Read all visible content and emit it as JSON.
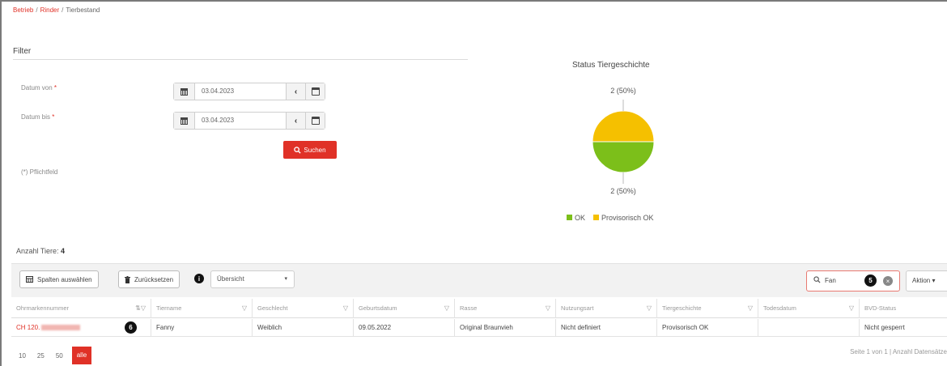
{
  "breadcrumb": {
    "items": [
      "Betrieb",
      "Rinder",
      "Tierbestand"
    ],
    "separator": "/"
  },
  "filter": {
    "title": "Filter",
    "date_from_label": "Datum von",
    "date_to_label": "Datum bis",
    "required_mark": "*",
    "date_from_value": "03.04.2023",
    "date_to_value": "03.04.2023",
    "prev_glyph": "‹",
    "search_label": "Suchen",
    "required_note": "(*) Pflichtfeld"
  },
  "chart_data": {
    "type": "pie",
    "title": "Status Tiergeschichte",
    "categories": [
      "OK",
      "Provisorisch OK"
    ],
    "values": [
      2,
      2
    ],
    "data_labels": [
      "2 (50%)",
      "2 (50%)"
    ],
    "colors": {
      "OK": "#7cbf1a",
      "Provisorisch OK": "#f5c000"
    },
    "legend_position": "bottom"
  },
  "summary": {
    "count_label": "Anzahl Tiere:",
    "count_value": "4"
  },
  "toolbar": {
    "columns_label": "Spalten auswählen",
    "reset_label": "Zurücksetzen",
    "info_badge": "i",
    "view_select": "Übersicht",
    "search_value": "Fan",
    "annotation_5": "5",
    "action_label": "Aktion"
  },
  "table": {
    "headers": [
      "Ohrmarkennummer",
      "Tiername",
      "Geschlecht",
      "Geburtsdatum",
      "Rasse",
      "Nutzungsart",
      "Tiergeschichte",
      "Todesdatum",
      "BVD-Status"
    ],
    "row": {
      "ear_tag": "CH 120.",
      "name": "Fanny",
      "sex": "Weiblich",
      "birth": "09.05.2022",
      "breed": "Original Braunvieh",
      "usage": "Nicht definiert",
      "history": "Provisorisch OK",
      "death": "",
      "bvd": "Nicht gesperrt"
    },
    "annotation_6": "6"
  },
  "pagination": {
    "sizes": [
      "10",
      "25",
      "50"
    ],
    "active": "alle",
    "info": "Seite 1 von 1 | Anzahl Datensätze"
  }
}
